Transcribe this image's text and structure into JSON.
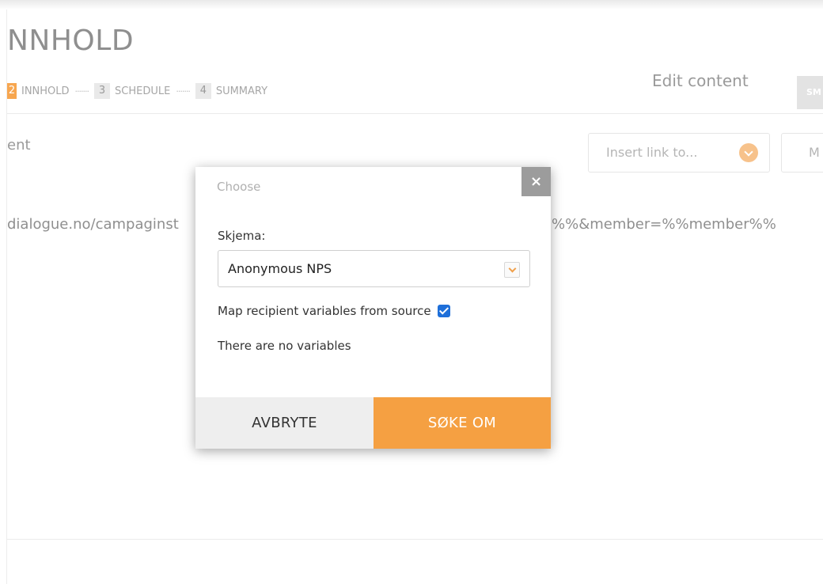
{
  "header": {
    "title": "NNHOLD",
    "edit_content": "Edit content",
    "top_button_label": "SM"
  },
  "steps": [
    {
      "number": "2",
      "label": "INNHOLD",
      "active": true
    },
    {
      "number": "3",
      "label": "SCHEDULE",
      "active": false
    },
    {
      "number": "4",
      "label": "SUMMARY",
      "active": false
    }
  ],
  "steps_separator": "·······",
  "content": {
    "section_label": "ent",
    "insert_link_label": "Insert link to...",
    "m_button_label": "M",
    "url_left": "dialogue.no/campaginst",
    "url_right": "%%&member=%%member%%"
  },
  "modal": {
    "title": "Choose",
    "close_symbol": "×",
    "field_label": "Skjema:",
    "select_value": "Anonymous NPS",
    "checkbox_label": "Map recipient variables from source",
    "checkbox_checked": true,
    "no_variables_text": "There are no variables",
    "cancel_label": "AVBRYTE",
    "ok_label": "SØKE OM"
  },
  "colors": {
    "accent": "#f5a042",
    "checkbox": "#1e6fd9",
    "close_bg": "#9c9c9c"
  }
}
